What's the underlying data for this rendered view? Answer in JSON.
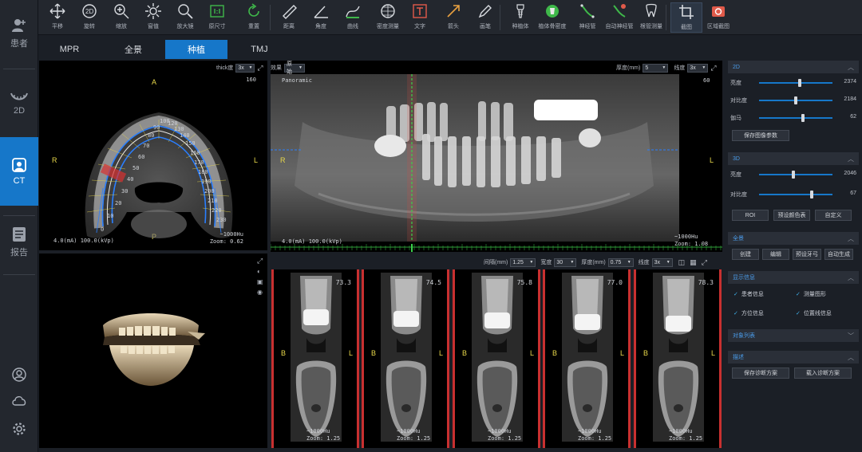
{
  "nav": {
    "patient": "患者",
    "twod": "2D",
    "ct": "CT",
    "report": "报告"
  },
  "toolbar": [
    {
      "label": "平移",
      "icon": "pan-icon"
    },
    {
      "label": "旋转",
      "icon": "rotate-2d-icon"
    },
    {
      "label": "缩放",
      "icon": "zoom-icon"
    },
    {
      "label": "窗值",
      "icon": "window-level-icon"
    },
    {
      "label": "放大镜",
      "icon": "magnifier-icon"
    },
    {
      "label": "原尺寸",
      "icon": "original-size-icon"
    },
    {
      "label": "重置",
      "icon": "reset-icon"
    },
    {
      "label": "距离",
      "icon": "ruler-icon"
    },
    {
      "label": "角度",
      "icon": "angle-icon"
    },
    {
      "label": "曲线",
      "icon": "curve-icon"
    },
    {
      "label": "密度测量",
      "icon": "density-icon"
    },
    {
      "label": "文字",
      "icon": "text-icon"
    },
    {
      "label": "箭头",
      "icon": "arrow-icon"
    },
    {
      "label": "画笔",
      "icon": "pen-icon"
    },
    {
      "label": "种植体",
      "icon": "implant-icon"
    },
    {
      "label": "植体骨密度",
      "icon": "implant-density-icon"
    },
    {
      "label": "神经管",
      "icon": "nerve-canal-icon"
    },
    {
      "label": "自动神经管",
      "icon": "auto-nerve-icon"
    },
    {
      "label": "根管测量",
      "icon": "root-canal-icon"
    },
    {
      "label": "截图",
      "icon": "crop-icon"
    },
    {
      "label": "区域截图",
      "icon": "region-capture-icon"
    }
  ],
  "tabs": [
    "MPR",
    "全景",
    "种植",
    "TMJ"
  ],
  "axial": {
    "thick_label": "thick度",
    "thick_val": "3x",
    "corner": "160",
    "A": "A",
    "P": "P",
    "R": "R",
    "L": "L",
    "bottom_left": "4.0(mA) 100.0(kVp)",
    "bottom_right_1": "~1000Hu",
    "bottom_right_2": "Zoom: 0.62",
    "arch_numbers": [
      "0",
      "10",
      "20",
      "30",
      "40",
      "50",
      "60",
      "70",
      "80",
      "90",
      "100",
      "230",
      "220",
      "210",
      "200",
      "190",
      "180",
      "170",
      "160",
      "150",
      "140",
      "130",
      "120",
      "110"
    ]
  },
  "pano": {
    "effect_label": "效果",
    "effect_val": "原始",
    "thick_label": "厚度(mm)",
    "thick_val": "5",
    "scale_label": "线度",
    "scale_val": "3x",
    "title": "Panoramic",
    "corner": "60",
    "R": "R",
    "L": "L",
    "bottom_left": "4.0(mA) 100.0(kVp)",
    "bottom_right_1": "~1000Hu",
    "bottom_right_2": "Zoom: 1.08"
  },
  "cross": {
    "interval_label": "间隔(mm)",
    "interval_val": "1.25",
    "width_label": "宽度",
    "width_val": "30",
    "thick_label": "厚度(mm)",
    "thick_val": "0.75",
    "scale_label": "线度",
    "scale_val": "3x",
    "slices": [
      {
        "num": "73.3",
        "hu": "~1000Hu",
        "zoom": "Zoom: 1.25"
      },
      {
        "num": "74.5",
        "hu": "~1000Hu",
        "zoom": "Zoom: 1.25"
      },
      {
        "num": "75.8",
        "hu": "~1000Hu",
        "zoom": "Zoom: 1.25"
      },
      {
        "num": "77.0",
        "hu": "~1000Hu",
        "zoom": "Zoom: 1.25"
      },
      {
        "num": "78.3",
        "hu": "~1000Hu",
        "zoom": "Zoom: 1.25"
      }
    ],
    "B": "B",
    "L": "L"
  },
  "panel": {
    "sec2d": "2D",
    "brightness": "亮度",
    "brightness_val": "2374",
    "brightness_pos": 0.55,
    "contrast": "对比度",
    "contrast_val": "2184",
    "contrast_pos": 0.5,
    "gamma": "伽马",
    "gamma_val": "62",
    "gamma_pos": 0.6,
    "save_params": "保存图像参数",
    "sec3d": "3D",
    "brightness3d": "亮度",
    "brightness3d_val": "2046",
    "brightness3d_pos": 0.47,
    "contrast3d": "对比度",
    "contrast3d_val": "67",
    "contrast3d_pos": 0.72,
    "roi": "ROI",
    "preset_color": "预设颜色表",
    "custom": "自定义",
    "sec_pano": "全景",
    "create": "创建",
    "edit": "编辑",
    "preset_arch": "预设牙弓",
    "auto_gen": "自动生成",
    "sec_display": "显示信息",
    "patient_info": "患者信息",
    "measure_shape": "测量图形",
    "orientation_info": "方位信息",
    "position_line": "位置线信息",
    "sec_objects": "对象列表",
    "sec_report": "描述",
    "save_plan": "保存诊断方案",
    "load_plan": "载入诊断方案"
  },
  "colors": {
    "accent": "#1677c9",
    "panel_bg": "#23272e",
    "label_yellow": "#e8d84a"
  }
}
